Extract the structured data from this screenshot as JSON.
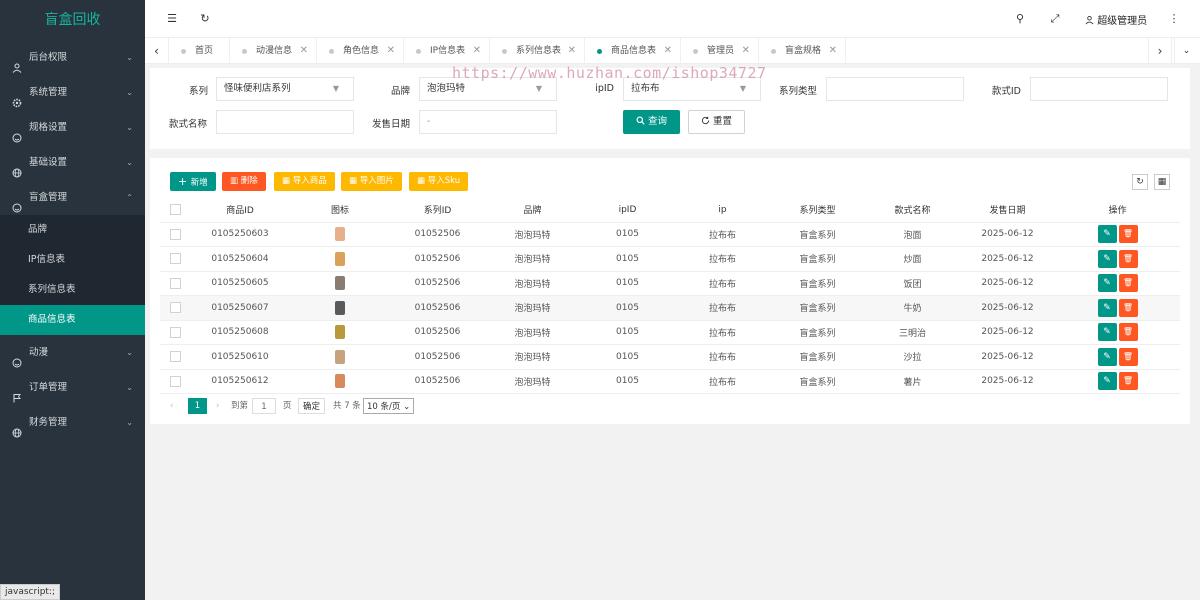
{
  "sidebar": {
    "logo": "盲盒回收",
    "items": [
      {
        "label": "后台权限",
        "icon": "user-icon",
        "arrow": "⌄"
      },
      {
        "label": "系统管理",
        "icon": "gear-icon",
        "arrow": "⌄"
      },
      {
        "label": "规格设置",
        "icon": "smile-icon",
        "arrow": "⌄"
      },
      {
        "label": "基础设置",
        "icon": "globe-icon",
        "arrow": "⌄"
      },
      {
        "label": "盲盒管理",
        "icon": "smile-icon",
        "arrow": "⌃"
      },
      {
        "label": "动漫",
        "icon": "smile-icon",
        "arrow": "⌄"
      },
      {
        "label": "订单管理",
        "icon": "flag-icon",
        "arrow": "⌄"
      },
      {
        "label": "财务管理",
        "icon": "globe-icon",
        "arrow": "⌄"
      }
    ],
    "subitems": [
      "品牌",
      "IP信息表",
      "系列信息表",
      "商品信息表"
    ],
    "active_sub": "商品信息表",
    "status_text": "javascript:;"
  },
  "topbar": {
    "menu_icon": "☰",
    "refresh_icon": "↻",
    "search_icon": "⚲",
    "fullscreen_icon": "⤢",
    "user_label": "超级管理员",
    "more_icon": "⋮"
  },
  "tabs": {
    "prev": "‹",
    "next": "›",
    "close_all": "⌄",
    "items": [
      {
        "label": "首页",
        "closable": false
      },
      {
        "label": "动漫信息",
        "closable": true
      },
      {
        "label": "角色信息",
        "closable": true
      },
      {
        "label": "IP信息表",
        "closable": true
      },
      {
        "label": "系列信息表",
        "closable": true
      },
      {
        "label": "商品信息表",
        "closable": true,
        "active": true
      },
      {
        "label": "管理员",
        "closable": true
      },
      {
        "label": "盲盒规格",
        "closable": true
      }
    ],
    "close_glyph": "✕"
  },
  "watermark": "https://www.huzhan.com/ishop34727",
  "search": {
    "series_label": "系列",
    "series_value": "怪味便利店系列",
    "brand_label": "品牌",
    "brand_value": "泡泡玛特",
    "ipid_label": "ipID",
    "ipid_value": "拉布布",
    "series_type_label": "系列类型",
    "series_type_value": "",
    "style_id_label": "款式ID",
    "style_id_value": "",
    "style_name_label": "款式名称",
    "style_name_value": "",
    "release_date_label": "发售日期",
    "release_date_value": "-",
    "query_label": "查询",
    "reset_label": "重置",
    "caret": "▼"
  },
  "toolbar": {
    "add": "新增",
    "delete": "删除",
    "import_goods": "导入商品",
    "import_images": "导入图片",
    "import_sku": "导入Sku",
    "refresh_icon": "↻",
    "columns_icon": "▦"
  },
  "table": {
    "columns": [
      "商品ID",
      "图标",
      "系列ID",
      "品牌",
      "ipID",
      "ip",
      "系列类型",
      "款式名称",
      "发售日期",
      "操作"
    ],
    "rows": [
      {
        "id": "0105250603",
        "series_id": "01052506",
        "brand": "泡泡玛特",
        "ipid": "0105",
        "ip": "拉布布",
        "series_type": "盲盒系列",
        "style": "泡面",
        "date": "2025-06-12",
        "thumb_color": "#e8b08a"
      },
      {
        "id": "0105250604",
        "series_id": "01052506",
        "brand": "泡泡玛特",
        "ipid": "0105",
        "ip": "拉布布",
        "series_type": "盲盒系列",
        "style": "炒面",
        "date": "2025-06-12",
        "thumb_color": "#d9a15a"
      },
      {
        "id": "0105250605",
        "series_id": "01052506",
        "brand": "泡泡玛特",
        "ipid": "0105",
        "ip": "拉布布",
        "series_type": "盲盒系列",
        "style": "饭团",
        "date": "2025-06-12",
        "thumb_color": "#8a7c70"
      },
      {
        "id": "0105250607",
        "series_id": "01052506",
        "brand": "泡泡玛特",
        "ipid": "0105",
        "ip": "拉布布",
        "series_type": "盲盒系列",
        "style": "牛奶",
        "date": "2025-06-12",
        "thumb_color": "#5a5a5a"
      },
      {
        "id": "0105250608",
        "series_id": "01052506",
        "brand": "泡泡玛特",
        "ipid": "0105",
        "ip": "拉布布",
        "series_type": "盲盒系列",
        "style": "三明治",
        "date": "2025-06-12",
        "thumb_color": "#b89a3c"
      },
      {
        "id": "0105250610",
        "series_id": "01052506",
        "brand": "泡泡玛特",
        "ipid": "0105",
        "ip": "拉布布",
        "series_type": "盲盒系列",
        "style": "沙拉",
        "date": "2025-06-12",
        "thumb_color": "#c7a27c"
      },
      {
        "id": "0105250612",
        "series_id": "01052506",
        "brand": "泡泡玛特",
        "ipid": "0105",
        "ip": "拉布布",
        "series_type": "盲盒系列",
        "style": "薯片",
        "date": "2025-06-12",
        "thumb_color": "#d98a5c"
      }
    ],
    "edit_glyph": "✎",
    "delete_glyph": "🗑"
  },
  "pager": {
    "prev": "‹",
    "current": "1",
    "next": "›",
    "goto_label": "到第",
    "goto_value": "1",
    "page_unit": "页",
    "confirm": "确定",
    "total": "共 7 条",
    "page_size": "10 条/页 ⌄"
  },
  "colors": {
    "accent": "#009688",
    "danger": "#ff5722",
    "warn": "#ffb800",
    "sidebar_bg": "#28333e"
  }
}
